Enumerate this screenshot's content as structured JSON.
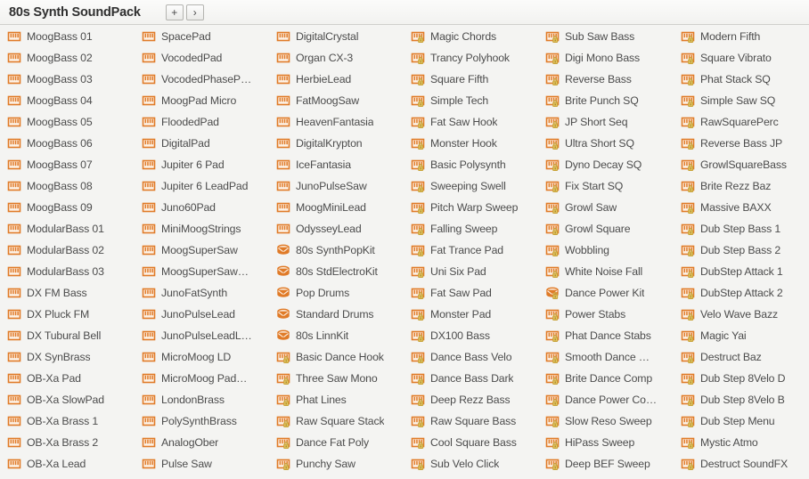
{
  "header": {
    "title": "80s Synth SoundPack",
    "buttons": [
      {
        "name": "add-button",
        "label": "+"
      },
      {
        "name": "next-button",
        "label": "›"
      }
    ]
  },
  "colors": {
    "icon_orange": "#e07b28",
    "icon_fill": "#fdf3e8",
    "lock_gold": "#c8a33a",
    "text": "#4c4c4c",
    "title": "#2f2f2f",
    "background": "#f4f4f2",
    "header_border": "#d0d0cc"
  },
  "icon_types": {
    "keyboard": "keyboard-icon",
    "keyboard_locked": "keyboard-locked-icon",
    "drum": "drum-icon",
    "drum_locked": "drum-locked-icon"
  },
  "columns": [
    {
      "name": "column-1",
      "items": [
        {
          "label": "MoogBass 01",
          "icon": "keyboard"
        },
        {
          "label": "MoogBass 02",
          "icon": "keyboard"
        },
        {
          "label": "MoogBass 03",
          "icon": "keyboard"
        },
        {
          "label": "MoogBass 04",
          "icon": "keyboard"
        },
        {
          "label": "MoogBass 05",
          "icon": "keyboard"
        },
        {
          "label": "MoogBass 06",
          "icon": "keyboard"
        },
        {
          "label": "MoogBass 07",
          "icon": "keyboard"
        },
        {
          "label": "MoogBass 08",
          "icon": "keyboard"
        },
        {
          "label": "MoogBass 09",
          "icon": "keyboard"
        },
        {
          "label": "ModularBass 01",
          "icon": "keyboard"
        },
        {
          "label": "ModularBass 02",
          "icon": "keyboard"
        },
        {
          "label": "ModularBass 03",
          "icon": "keyboard"
        },
        {
          "label": "DX FM Bass",
          "icon": "keyboard"
        },
        {
          "label": "DX Pluck FM",
          "icon": "keyboard"
        },
        {
          "label": "DX Tubural Bell",
          "icon": "keyboard"
        },
        {
          "label": "DX SynBrass",
          "icon": "keyboard"
        },
        {
          "label": "OB-Xa Pad",
          "icon": "keyboard"
        },
        {
          "label": "OB-Xa SlowPad",
          "icon": "keyboard"
        },
        {
          "label": "OB-Xa Brass 1",
          "icon": "keyboard"
        },
        {
          "label": "OB-Xa Brass 2",
          "icon": "keyboard"
        },
        {
          "label": "OB-Xa Lead",
          "icon": "keyboard"
        }
      ]
    },
    {
      "name": "column-2",
      "items": [
        {
          "label": "SpacePad",
          "icon": "keyboard"
        },
        {
          "label": "VocodedPad",
          "icon": "keyboard"
        },
        {
          "label": "VocodedPhaseP…",
          "icon": "keyboard"
        },
        {
          "label": "MoogPad Micro",
          "icon": "keyboard"
        },
        {
          "label": "FloodedPad",
          "icon": "keyboard"
        },
        {
          "label": "DigitalPad",
          "icon": "keyboard"
        },
        {
          "label": "Jupiter 6 Pad",
          "icon": "keyboard"
        },
        {
          "label": "Jupiter 6 LeadPad",
          "icon": "keyboard"
        },
        {
          "label": "Juno60Pad",
          "icon": "keyboard"
        },
        {
          "label": "MiniMoogStrings",
          "icon": "keyboard"
        },
        {
          "label": "MoogSuperSaw",
          "icon": "keyboard"
        },
        {
          "label": "MoogSuperSaw…",
          "icon": "keyboard"
        },
        {
          "label": "JunoFatSynth",
          "icon": "keyboard"
        },
        {
          "label": "JunoPulseLead",
          "icon": "keyboard"
        },
        {
          "label": "JunoPulseLeadL…",
          "icon": "keyboard"
        },
        {
          "label": "MicroMoog LD",
          "icon": "keyboard"
        },
        {
          "label": "MicroMoog Pad…",
          "icon": "keyboard"
        },
        {
          "label": "LondonBrass",
          "icon": "keyboard"
        },
        {
          "label": "PolySynthBrass",
          "icon": "keyboard"
        },
        {
          "label": "AnalogOber",
          "icon": "keyboard"
        },
        {
          "label": "Pulse Saw",
          "icon": "keyboard"
        }
      ]
    },
    {
      "name": "column-3",
      "items": [
        {
          "label": "DigitalCrystal",
          "icon": "keyboard"
        },
        {
          "label": "Organ CX-3",
          "icon": "keyboard"
        },
        {
          "label": "HerbieLead",
          "icon": "keyboard"
        },
        {
          "label": "FatMoogSaw",
          "icon": "keyboard"
        },
        {
          "label": "HeavenFantasia",
          "icon": "keyboard"
        },
        {
          "label": "DigitalKrypton",
          "icon": "keyboard"
        },
        {
          "label": "IceFantasia",
          "icon": "keyboard"
        },
        {
          "label": "JunoPulseSaw",
          "icon": "keyboard"
        },
        {
          "label": "MoogMiniLead",
          "icon": "keyboard"
        },
        {
          "label": "OdysseyLead",
          "icon": "keyboard"
        },
        {
          "label": "80s SynthPopKit",
          "icon": "drum"
        },
        {
          "label": "80s StdElectroKit",
          "icon": "drum"
        },
        {
          "label": "Pop Drums",
          "icon": "drum"
        },
        {
          "label": "Standard Drums",
          "icon": "drum"
        },
        {
          "label": "80s LinnKit",
          "icon": "drum"
        },
        {
          "label": "Basic Dance Hook",
          "icon": "keyboard_locked"
        },
        {
          "label": "Three Saw Mono",
          "icon": "keyboard_locked"
        },
        {
          "label": "Phat Lines",
          "icon": "keyboard_locked"
        },
        {
          "label": "Raw Square Stack",
          "icon": "keyboard_locked"
        },
        {
          "label": "Dance Fat Poly",
          "icon": "keyboard_locked"
        },
        {
          "label": "Punchy Saw",
          "icon": "keyboard_locked"
        }
      ]
    },
    {
      "name": "column-4",
      "items": [
        {
          "label": "Magic Chords",
          "icon": "keyboard_locked"
        },
        {
          "label": "Trancy Polyhook",
          "icon": "keyboard_locked"
        },
        {
          "label": "Square Fifth",
          "icon": "keyboard_locked"
        },
        {
          "label": "Simple Tech",
          "icon": "keyboard_locked"
        },
        {
          "label": "Fat Saw Hook",
          "icon": "keyboard_locked"
        },
        {
          "label": "Monster Hook",
          "icon": "keyboard_locked"
        },
        {
          "label": "Basic Polysynth",
          "icon": "keyboard_locked"
        },
        {
          "label": "Sweeping Swell",
          "icon": "keyboard_locked"
        },
        {
          "label": "Pitch Warp Sweep",
          "icon": "keyboard_locked"
        },
        {
          "label": "Falling Sweep",
          "icon": "keyboard_locked"
        },
        {
          "label": "Fat Trance Pad",
          "icon": "keyboard_locked"
        },
        {
          "label": "Uni Six Pad",
          "icon": "keyboard_locked"
        },
        {
          "label": "Fat Saw Pad",
          "icon": "keyboard_locked"
        },
        {
          "label": "Monster Pad",
          "icon": "keyboard_locked"
        },
        {
          "label": "DX100 Bass",
          "icon": "keyboard_locked"
        },
        {
          "label": "Dance Bass Velo",
          "icon": "keyboard_locked"
        },
        {
          "label": "Dance Bass Dark",
          "icon": "keyboard_locked"
        },
        {
          "label": "Deep Rezz Bass",
          "icon": "keyboard_locked"
        },
        {
          "label": "Raw Square Bass",
          "icon": "keyboard_locked"
        },
        {
          "label": "Cool Square Bass",
          "icon": "keyboard_locked"
        },
        {
          "label": "Sub Velo Click",
          "icon": "keyboard_locked"
        }
      ]
    },
    {
      "name": "column-5",
      "items": [
        {
          "label": "Sub Saw Bass",
          "icon": "keyboard_locked"
        },
        {
          "label": "Digi Mono Bass",
          "icon": "keyboard_locked"
        },
        {
          "label": "Reverse Bass",
          "icon": "keyboard_locked"
        },
        {
          "label": "Brite Punch SQ",
          "icon": "keyboard_locked"
        },
        {
          "label": "JP Short Seq",
          "icon": "keyboard_locked"
        },
        {
          "label": "Ultra Short SQ",
          "icon": "keyboard_locked"
        },
        {
          "label": "Dyno Decay SQ",
          "icon": "keyboard_locked"
        },
        {
          "label": "Fix Start SQ",
          "icon": "keyboard_locked"
        },
        {
          "label": "Growl Saw",
          "icon": "keyboard_locked"
        },
        {
          "label": "Growl Square",
          "icon": "keyboard_locked"
        },
        {
          "label": "Wobbling",
          "icon": "keyboard_locked"
        },
        {
          "label": "White Noise Fall",
          "icon": "keyboard_locked"
        },
        {
          "label": "Dance Power Kit",
          "icon": "drum_locked"
        },
        {
          "label": "Power Stabs",
          "icon": "keyboard_locked"
        },
        {
          "label": "Phat Dance Stabs",
          "icon": "keyboard_locked"
        },
        {
          "label": "Smooth Dance …",
          "icon": "keyboard_locked"
        },
        {
          "label": "Brite Dance Comp",
          "icon": "keyboard_locked"
        },
        {
          "label": "Dance Power Co…",
          "icon": "keyboard_locked"
        },
        {
          "label": "Slow Reso Sweep",
          "icon": "keyboard_locked"
        },
        {
          "label": "HiPass Sweep",
          "icon": "keyboard_locked"
        },
        {
          "label": "Deep BEF Sweep",
          "icon": "keyboard_locked"
        }
      ]
    },
    {
      "name": "column-6",
      "items": [
        {
          "label": "Modern Fifth",
          "icon": "keyboard_locked"
        },
        {
          "label": "Square Vibrato",
          "icon": "keyboard_locked"
        },
        {
          "label": "Phat Stack SQ",
          "icon": "keyboard_locked"
        },
        {
          "label": "Simple Saw SQ",
          "icon": "keyboard_locked"
        },
        {
          "label": "RawSquarePerc",
          "icon": "keyboard_locked"
        },
        {
          "label": "Reverse Bass JP",
          "icon": "keyboard_locked"
        },
        {
          "label": "GrowlSquareBass",
          "icon": "keyboard_locked"
        },
        {
          "label": "Brite Rezz Baz",
          "icon": "keyboard_locked"
        },
        {
          "label": "Massive BAXX",
          "icon": "keyboard_locked"
        },
        {
          "label": "Dub Step Bass 1",
          "icon": "keyboard_locked"
        },
        {
          "label": "Dub Step Bass 2",
          "icon": "keyboard_locked"
        },
        {
          "label": "DubStep Attack 1",
          "icon": "keyboard_locked"
        },
        {
          "label": "DubStep Attack 2",
          "icon": "keyboard_locked"
        },
        {
          "label": "Velo Wave Bazz",
          "icon": "keyboard_locked"
        },
        {
          "label": "Magic Yai",
          "icon": "keyboard_locked"
        },
        {
          "label": "Destruct Baz",
          "icon": "keyboard_locked"
        },
        {
          "label": "Dub Step 8Velo D",
          "icon": "keyboard_locked"
        },
        {
          "label": "Dub Step 8Velo B",
          "icon": "keyboard_locked"
        },
        {
          "label": "Dub Step Menu",
          "icon": "keyboard_locked"
        },
        {
          "label": "Mystic Atmo",
          "icon": "keyboard_locked"
        },
        {
          "label": "Destruct SoundFX",
          "icon": "keyboard_locked"
        }
      ]
    }
  ]
}
